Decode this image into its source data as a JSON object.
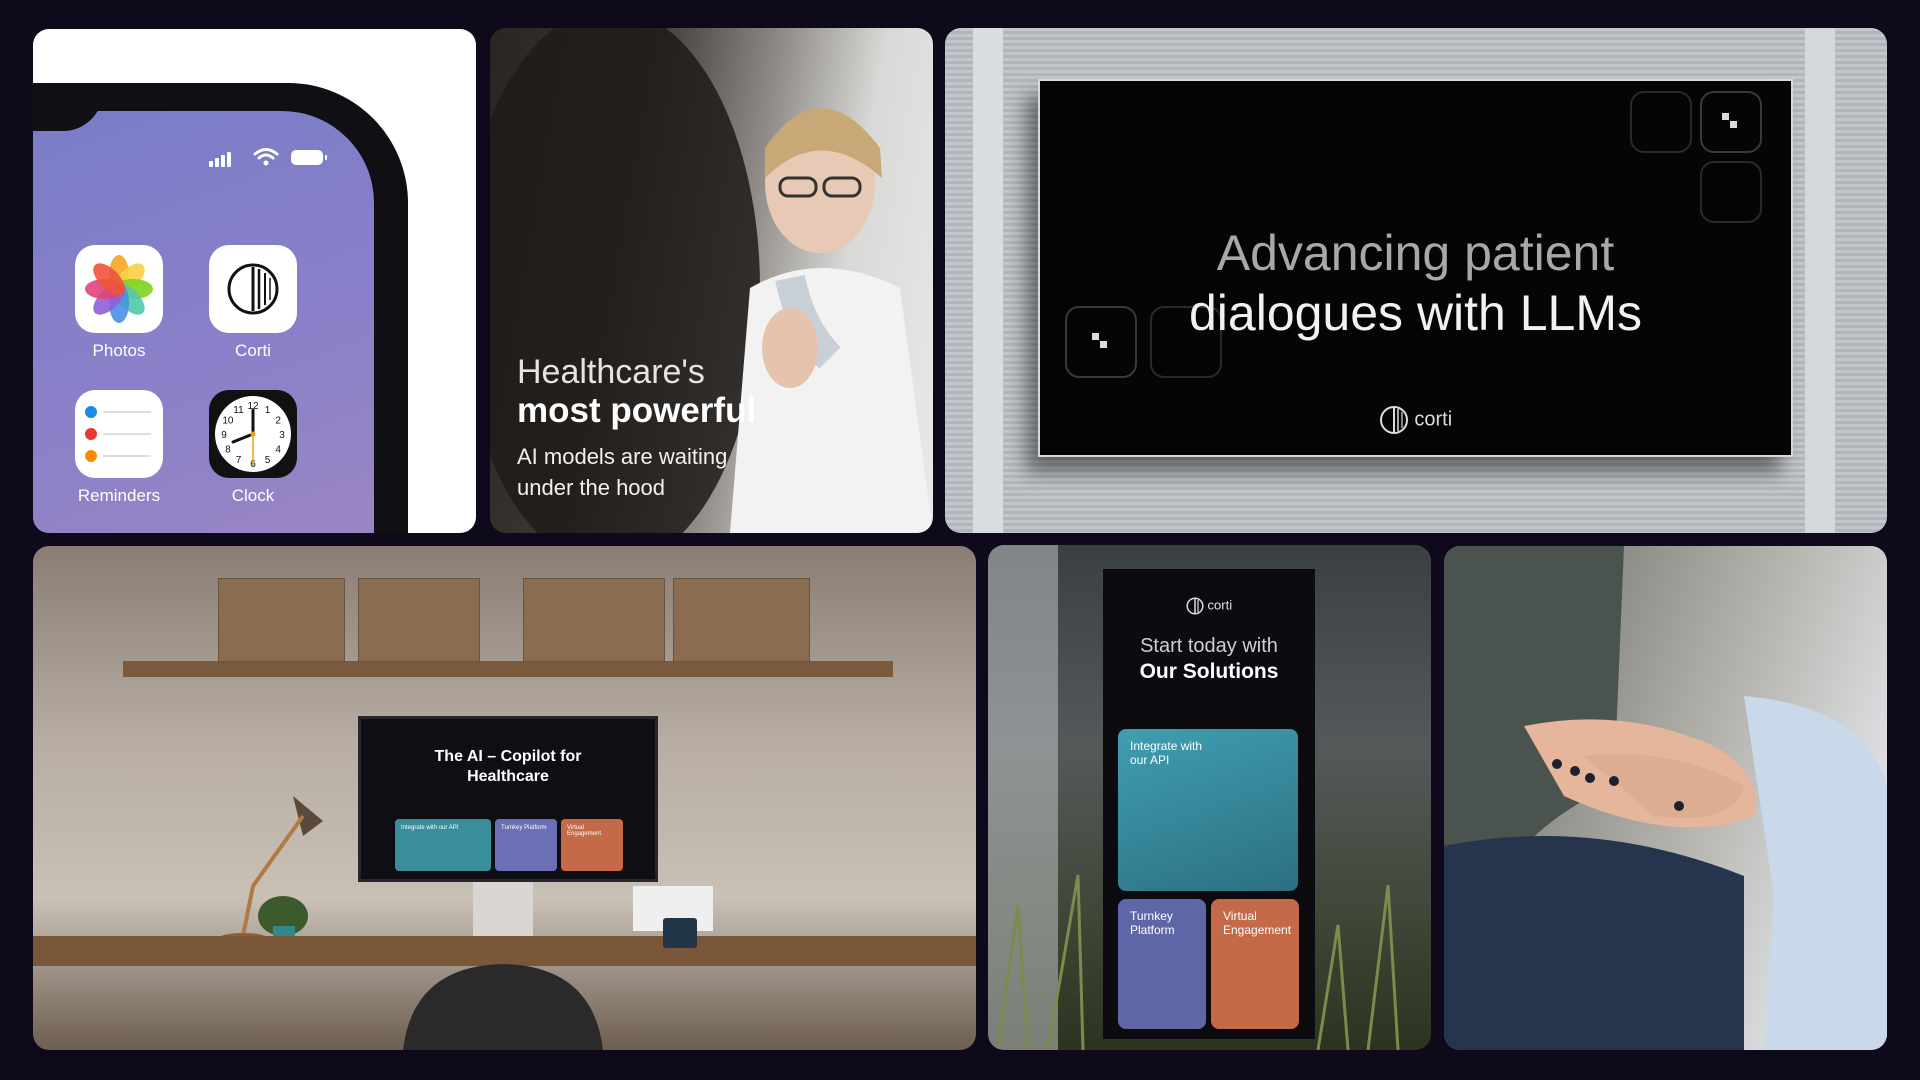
{
  "phone": {
    "apps": [
      {
        "label": "Photos",
        "icon": "photos-icon"
      },
      {
        "label": "Corti",
        "icon": "corti-logo-icon"
      },
      {
        "label": "Reminders",
        "icon": "reminders-icon"
      },
      {
        "label": "Clock",
        "icon": "clock-icon"
      }
    ],
    "clock_numbers": [
      "12",
      "1",
      "2",
      "3",
      "4",
      "5",
      "6",
      "7",
      "8",
      "9",
      "10",
      "11"
    ]
  },
  "healthcare_card": {
    "line1": "Healthcare's",
    "line2": "most powerful",
    "line3": "AI models are waiting",
    "line4": "under the hood"
  },
  "billboard": {
    "line1": "Advancing patient",
    "line2": "dialogues with LLMs",
    "brand": "corti"
  },
  "monitor": {
    "headline_1": "The AI – Copilot for",
    "headline_2": "Healthcare",
    "cards": [
      "Integrate with our API",
      "Turnkey Platform",
      "Virtual Engagement"
    ]
  },
  "outdoor_sign": {
    "brand": "corti",
    "line1": "Start today with",
    "line2": "Our Solutions",
    "card1_line1": "Integrate with",
    "card1_line2": "our API",
    "card2_line1": "Turnkey",
    "card2_line2": "Platform",
    "card3_line1": "Virtual",
    "card3_line2": "Engagement"
  },
  "colors": {
    "background": "#0e0a1b",
    "phone_screen": "#8a80c9",
    "teal_card": "#3a8e9b",
    "purple_card": "#6b6fb3",
    "orange_card": "#c46a48"
  }
}
